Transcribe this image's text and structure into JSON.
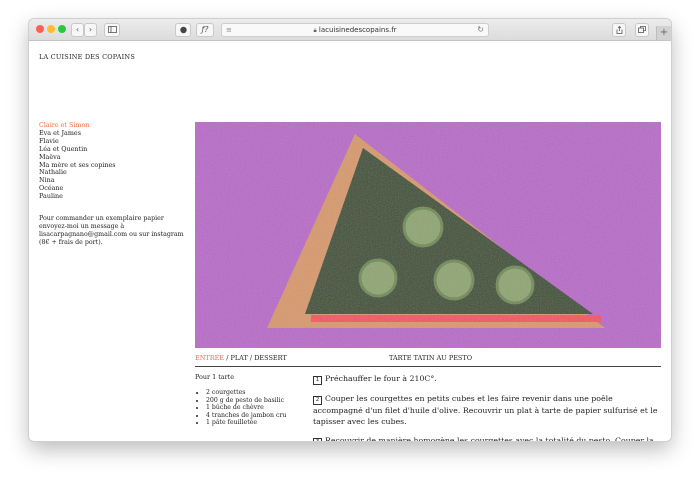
{
  "browser": {
    "url": "lacuisinedescopains.fr",
    "shield_icon": "shield-icon",
    "reader_label": "ƒ?"
  },
  "site": {
    "title": "LA CUISINE DES COPAINS"
  },
  "nav": [
    {
      "label": "Claire et Simon",
      "active": true
    },
    {
      "label": "Eva et James",
      "active": false
    },
    {
      "label": "Flavie",
      "active": false
    },
    {
      "label": "Léa et Quentin",
      "active": false
    },
    {
      "label": "Maëva",
      "active": false
    },
    {
      "label": "Ma mère et ses copines",
      "active": false
    },
    {
      "label": "Nathalie",
      "active": false
    },
    {
      "label": "Nina",
      "active": false
    },
    {
      "label": "Océane",
      "active": false
    },
    {
      "label": "Pauline",
      "active": false
    }
  ],
  "order_text": "Pour commander un exemplaire papier envoyez-moi un message à lisacarpagnano@gmail.com ou sur instagram (8€ + frais de port).",
  "colors": {
    "accent": "#f0703a",
    "art_background": "#b86ac8",
    "triangle_fill": "#3c4f33",
    "triangle_border": "#d79a6c",
    "stripe": "#f0545c",
    "circle": "#8fa672"
  },
  "categories": {
    "entree": "ENTRÉE",
    "sep1": " / ",
    "plat": "PLAT",
    "sep2": " / ",
    "dessert": "DESSERT"
  },
  "recipe": {
    "title": "TARTE TATIN AU PESTO",
    "serves": "Pour 1 tarte",
    "ingredients": [
      "2 courgettes",
      "200 g de pesto de basilic",
      "1 bûche de chèvre",
      "4 tranches de jambon cru",
      "1 pâte feuilletée"
    ],
    "steps": [
      {
        "n": "1",
        "text": "Préchauffer le four à 210C°."
      },
      {
        "n": "2",
        "text": "Couper les courgettes en petits cubes et les faire revenir dans une poêle accompagné d'un filet d'huile d'olive. Recouvrir un plat à tarte de papier sulfurisé et le tapisser avec les cubes."
      },
      {
        "n": "3",
        "text": "Recouvrir de manière homogène les courgettes avec la totalité du pesto. Couper la bûche de chèvre en tranches et les disposer de manière homogène par-dessus le pesto. Découper en petits morceaux quatre tranches de jambon cru à l'aide de ciseaux et les"
      }
    ]
  }
}
